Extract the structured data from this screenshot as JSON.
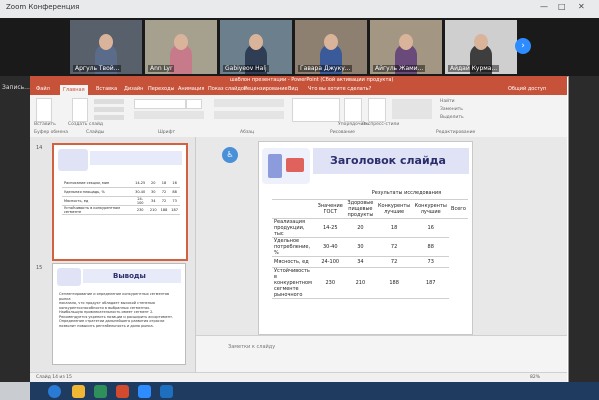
{
  "window": {
    "title": "Zoom Конференция"
  },
  "participants": [
    {
      "name": "Аргуль Твой...",
      "shirt": "#5a6c8a",
      "bg": "#58606c"
    },
    {
      "name": "Ann Lyr",
      "shirt": "#c77a8a",
      "bg": "#a6a18f"
    },
    {
      "name": "Gabiyeov Halj",
      "shirt": "#2f3d55",
      "bg": "#6b7f8c"
    },
    {
      "name": "Гавара Джуку...",
      "shirt": "#3b5a9a",
      "bg": "#8e8070"
    },
    {
      "name": "Айгуль Жами...",
      "shirt": "#6a4a7a",
      "bg": "#a39783"
    },
    {
      "name": "Айдай Курма...",
      "shirt": "#3e3e3e",
      "bg": "#cfcfcf"
    }
  ],
  "left_panel": {
    "label": "Запись..."
  },
  "ppt": {
    "title": "шаблон презентации - PowerPoint (Сбой активации продукта)",
    "tabs": [
      "Файл",
      "Главная",
      "Вставка",
      "Дизайн",
      "Переходы",
      "Анимация",
      "Показ слайдов",
      "Рецензирование",
      "Вид",
      "Что вы хотите сделать?"
    ],
    "share": "Общий доступ",
    "ribbon_groups": [
      "Буфер обмена",
      "Слайды",
      "Шрифт",
      "Абзац",
      "Рисование",
      "Редактирование"
    ],
    "ribbon_buttons": [
      "Вставить",
      "Создать слайд",
      "Упорядочить",
      "Экспресс-стили",
      "Найти",
      "Заменить",
      "Выделить"
    ]
  },
  "thumbs": [
    {
      "num": "14",
      "rows": [
        [
          "Расписание секции, мин",
          "14-25",
          "20",
          "18",
          "16"
        ],
        [
          "Удельная площадь, %",
          "30-40",
          "30",
          "72",
          "88"
        ],
        [
          "Мясность, ед",
          "24-100",
          "34",
          "72",
          "73"
        ],
        [
          "Устойчивость в конкурентном сегменте",
          "230",
          "210",
          "188",
          "187"
        ]
      ]
    },
    {
      "num": "15",
      "title": "Выводы",
      "lines": [
        "Сегментирование и определение конкурентных сегментов рынка",
        "показало, что продукт обладает высокой степенью",
        "конкурентоспособности в выбранных сегментах.",
        "Наибольшую привлекательность имеет сегмент 2.",
        "Рекомендуется укрепить позиции и расширить ассортимент.",
        "Определение стратегии дальнейшего развития отрасли",
        "позволит повысить рентабельность и долю рынка."
      ]
    }
  ],
  "slide": {
    "title": "Заголовок слайда",
    "group_header": "Результаты исследования",
    "col_headers": [
      "Значение ГОСТ",
      "Здоровые пищевые продукты",
      "Конкуренты лучшие",
      "Конкуренты лучшие",
      "Всего"
    ],
    "rows": [
      [
        "Реализация продукции, тыс",
        "14-25",
        "20",
        "18",
        "16"
      ],
      [
        "Удельное потребление, %",
        "30-40",
        "30",
        "72",
        "88"
      ],
      [
        "Мясность, ед",
        "24-100",
        "34",
        "72",
        "73"
      ],
      [
        "Устойчивость в конкурентном сегменте рыночного",
        "230",
        "210",
        "188",
        "187"
      ]
    ]
  },
  "notes": {
    "placeholder": "Заметки к слайду"
  },
  "status": {
    "left": "Слайд 14 из 15",
    "right": "82%"
  },
  "colors": {
    "accent": "#c7523a",
    "slide_title": "#2b2e6b",
    "zoom_blue": "#2d8cff"
  }
}
